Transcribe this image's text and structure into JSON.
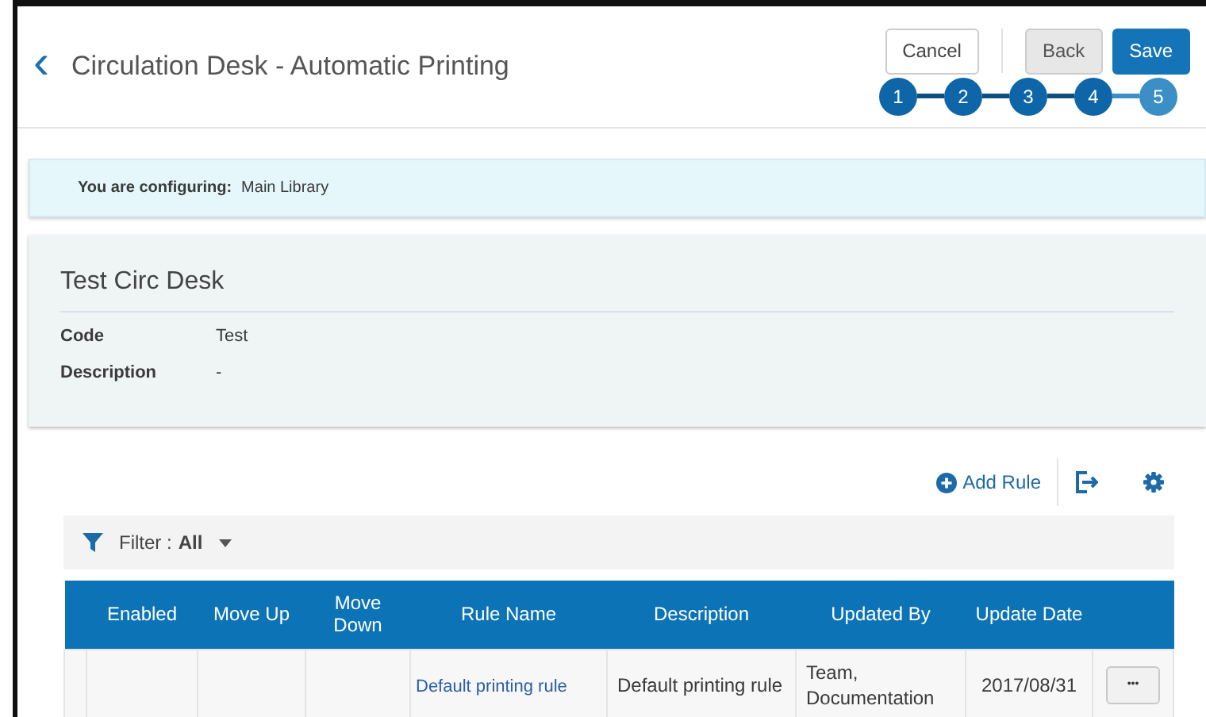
{
  "header": {
    "back": "‹",
    "title": "Circulation Desk - Automatic Printing",
    "buttons": [
      {
        "label": "Cancel",
        "kind": "outline"
      },
      {
        "label": "Back",
        "kind": "grey"
      },
      {
        "label": "Save",
        "kind": "primary"
      }
    ],
    "steps": [
      {
        "label": "1",
        "selected": false
      },
      {
        "label": "2",
        "selected": false
      },
      {
        "label": "3",
        "selected": false
      },
      {
        "label": "4",
        "selected": false
      },
      {
        "label": "5",
        "selected": true
      }
    ]
  },
  "context": {
    "label": "You are configuring:",
    "value": "Main Library"
  },
  "details": {
    "title": "Test Circ Desk",
    "fields": [
      {
        "label": "Code",
        "value": "Test"
      },
      {
        "label": "Description",
        "value": "-"
      }
    ]
  },
  "toolbar": {
    "add": "Add Rule"
  },
  "filter": {
    "label": "Filter :",
    "value": "All"
  },
  "table": {
    "columns": [
      "",
      "Enabled",
      "Move Up",
      "Move Down",
      "Rule Name",
      "Description",
      "Updated By",
      "Update Date",
      ""
    ],
    "rows": [
      {
        "rule_name": "Default printing rule",
        "description": "Default printing rule",
        "updated_by": "Team, Documentation",
        "update_date": "2017/08/31",
        "menu": "•••"
      }
    ]
  }
}
